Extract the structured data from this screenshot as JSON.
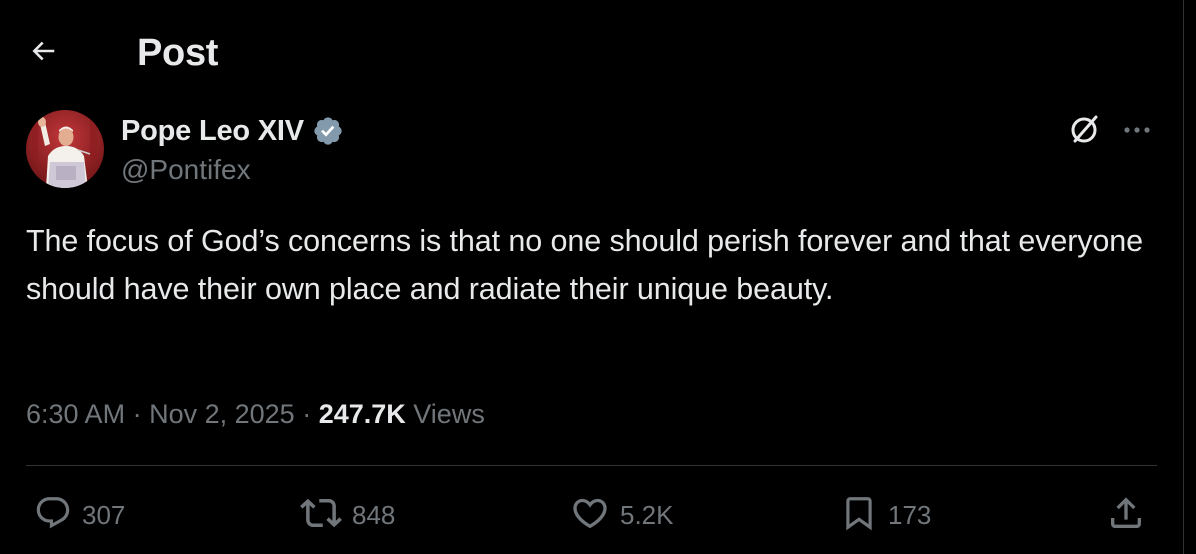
{
  "header": {
    "back_icon": "arrow-left-icon",
    "title": "Post"
  },
  "author": {
    "name": "Pope Leo XIV",
    "handle": "@Pontifex",
    "verified": true,
    "avatar_icon": "avatar-photo",
    "badge_color": "#829aab"
  },
  "top_actions": {
    "grok_icon": "grok-icon",
    "more_icon": "more-horizontal-icon"
  },
  "post": {
    "text": "The focus of God’s concerns is that no one should perish forever and that everyone should have their own place and radiate their unique beauty.",
    "time": "6:30 AM",
    "separator": "·",
    "date": "Nov 2, 2025",
    "views_count": "247.7K",
    "views_label": "Views"
  },
  "actions": {
    "replies": "307",
    "reposts": "848",
    "likes": "5.2K",
    "bookmarks": "173",
    "share_icon": "share-icon"
  },
  "colors": {
    "background": "#000000",
    "text_primary": "#e7e9ea",
    "text_secondary": "#71767b",
    "divider": "#2f3336"
  }
}
